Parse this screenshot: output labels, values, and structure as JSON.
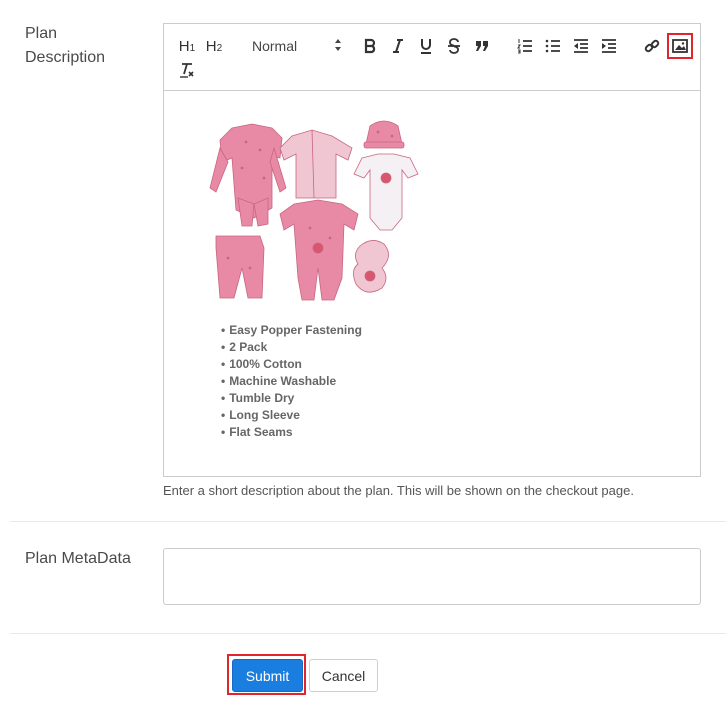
{
  "form": {
    "description_label": "Plan Description",
    "metadata_label": "Plan MetaData",
    "helper_text": "Enter a short description about the plan. This will be shown on the checkout page.",
    "metadata_value": ""
  },
  "toolbar": {
    "h1": "H1",
    "h2": "H2",
    "header_select_value": "Normal",
    "items": [
      "bold-icon",
      "italic-icon",
      "underline-icon",
      "strike-icon",
      "blockquote-icon",
      "ordered-list-icon",
      "bullet-list-icon",
      "outdent-icon",
      "indent-icon",
      "link-icon",
      "image-icon",
      "clear-format-icon"
    ]
  },
  "editor": {
    "features": [
      "Easy Popper Fastening",
      "2 Pack",
      "100% Cotton",
      "Machine Washable",
      "Tumble Dry",
      "Long Sleeve",
      "Flat Seams"
    ]
  },
  "actions": {
    "submit_label": "Submit",
    "cancel_label": "Cancel"
  },
  "colors": {
    "primary": "#1a7ee0",
    "highlight": "#e0262c",
    "product_pink": "#e88aa6"
  }
}
